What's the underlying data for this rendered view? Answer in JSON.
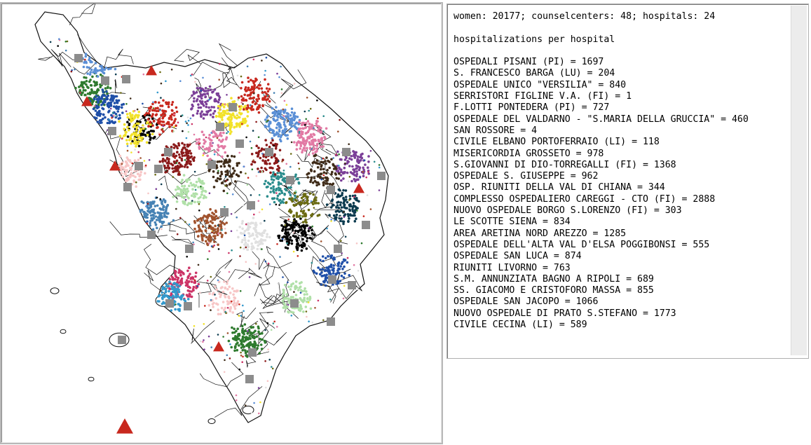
{
  "map": {
    "colors": {
      "boundary": "#111111",
      "hospital_marker": "#8c8c8c",
      "counselcenter_marker": "#c8281e",
      "clusters": [
        "#2e7a2e",
        "#1f4fa8",
        "#000000",
        "#7b3f98",
        "#f2e22a",
        "#c8281e",
        "#5a8fd6",
        "#e27aa4",
        "#8b1a1a",
        "#3f2b18",
        "#f7c6c6",
        "#b0e0a8",
        "#2a8c8c",
        "#0c3b4f",
        "#6b6b13",
        "#e0e0e0",
        "#a0522d",
        "#4682b4",
        "#cc3366",
        "#3399cc"
      ]
    }
  },
  "output": {
    "lines": [
      "women: 20177; counselcenters: 48; hospitals: 24",
      "",
      "hospitalizations per hospital",
      "",
      "OSPEDALI PISANI (PI) = 1697",
      "S. FRANCESCO BARGA (LU) = 204",
      "OSPEDALE UNICO \"VERSILIA\" = 840",
      "SERRISTORI FIGLINE V.A. (FI) = 1",
      "F.LOTTI PONTEDERA (PI) = 727",
      "OSPEDALE DEL VALDARNO - \"S.MARIA DELLA GRUCCIA\" = 460",
      "SAN ROSSORE = 4",
      "CIVILE ELBANO PORTOFERRAIO (LI) = 118",
      "MISERICORDIA GROSSETO = 978",
      "S.GIOVANNI DI DIO-TORREGALLI (FI) = 1368",
      "OSPEDALE S. GIUSEPPE = 962",
      "OSP. RIUNITI DELLA VAL DI CHIANA = 344",
      "COMPLESSO OSPEDALIERO CAREGGI - CTO (FI) = 2888",
      "NUOVO OSPEDALE BORGO S.LORENZO (FI) = 303",
      "LE SCOTTE SIENA = 834",
      "AREA ARETINA NORD AREZZO = 1285",
      "OSPEDALE DELL'ALTA VAL D'ELSA POGGIBONSI = 555",
      "OSPEDALE SAN LUCA = 874",
      "RIUNITI LIVORNO = 763",
      "S.M. ANNUNZIATA BAGNO A RIPOLI = 689",
      "SS. GIACOMO E CRISTOFORO MASSA = 855",
      "OSPEDALE SAN JACOPO = 1066",
      "NUOVO OSPEDALE DI PRATO S.STEFANO = 1773",
      "CIVILE CECINA (LI) = 589"
    ]
  }
}
